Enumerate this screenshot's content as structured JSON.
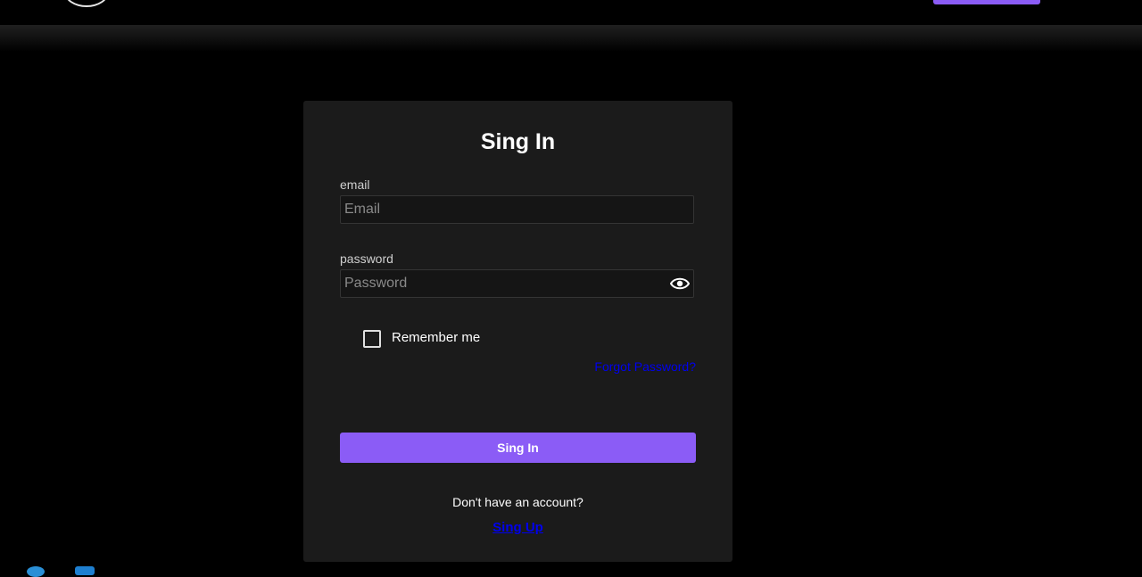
{
  "header": {
    "nav_button_color": "#8b5cf6"
  },
  "form": {
    "title": "Sing In",
    "email_label": "email",
    "email_placeholder": "Email",
    "password_label": "password",
    "password_placeholder": "Password",
    "show_password_icon": "eye-icon",
    "remember_label": "Remember me",
    "remember_checked": false,
    "forgot_link": "Forgot Password?",
    "submit_label": "Sing In",
    "no_account_text": "Don't have an account?",
    "signup_link": "Sing Up"
  },
  "colors": {
    "accent": "#8b5cf6",
    "link": "#0000ee",
    "card_bg": "#1b1b1b",
    "page_bg": "#000000"
  }
}
